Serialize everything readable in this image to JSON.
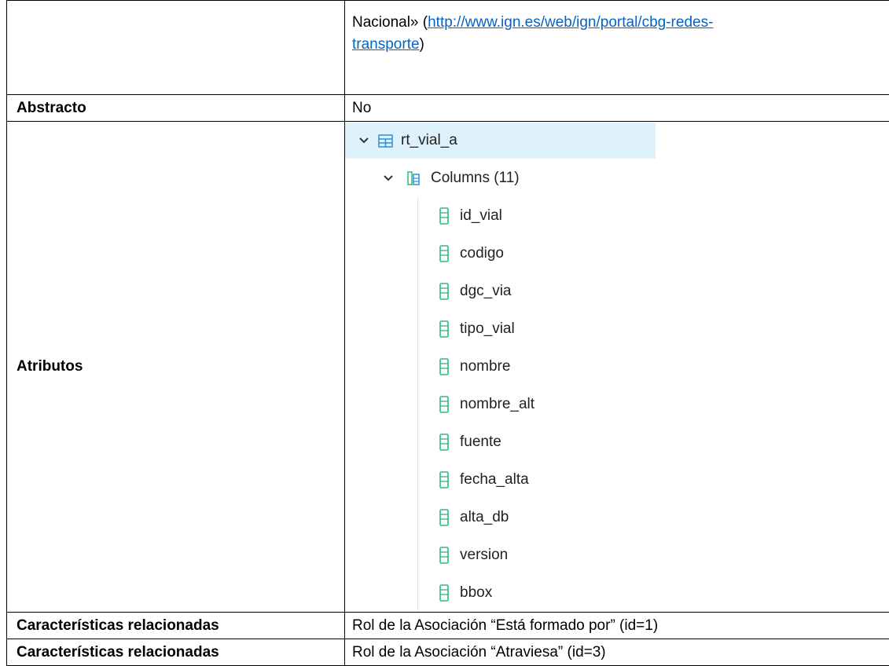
{
  "rows": {
    "top": {
      "value_prefix": "Nacional» (",
      "link": "http://www.ign.es/web/ign/portal/cbg-redes-transporte",
      "link_line1": "http://www.ign.es/web/ign/portal/cbg-redes-",
      "link_line2": "transporte",
      "value_suffix": ")"
    },
    "abstract": {
      "label": "Abstracto",
      "value": "No"
    },
    "attributes": {
      "label": "Atributos",
      "tree": {
        "table_name": "rt_vial_a",
        "group_label": "Columns (11)",
        "columns": [
          "id_vial",
          "codigo",
          "dgc_via",
          "tipo_vial",
          "nombre",
          "nombre_alt",
          "fuente",
          "fecha_alta",
          "alta_db",
          "version",
          "bbox"
        ]
      }
    },
    "related1": {
      "label": "Características relacionadas",
      "value": "Rol de la Asociación “Está formado por” (id=1)"
    },
    "related2": {
      "label": "Características relacionadas",
      "value": "Rol de la Asociación “Atraviesa” (id=3)"
    }
  },
  "colors": {
    "tree_selected_bg": "#dff1fb",
    "icon_green": "#2fb87c",
    "icon_blue": "#2f8fd8",
    "link": "#0563c1"
  },
  "icons": {
    "expand": "chevron-down-icon",
    "table": "table-icon",
    "columns": "columns-icon",
    "column": "column-icon"
  }
}
